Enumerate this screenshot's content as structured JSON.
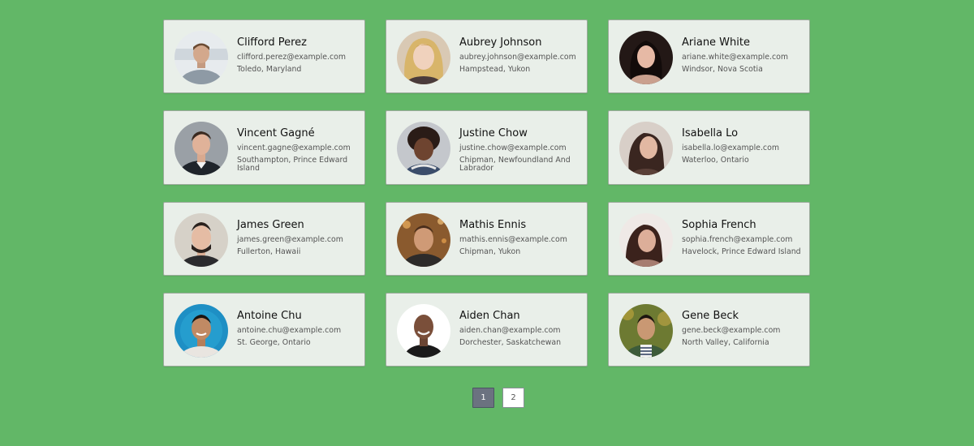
{
  "colors": {
    "background": "#62b767",
    "card": "#e9efe9",
    "active_page": "#6b7280"
  },
  "users": [
    {
      "name": "Clifford Perez",
      "email": "clifford.perez@example.com",
      "location": "Toledo, Maryland"
    },
    {
      "name": "Aubrey Johnson",
      "email": "aubrey.johnson@example.com",
      "location": "Hampstead, Yukon"
    },
    {
      "name": "Ariane White",
      "email": "ariane.white@example.com",
      "location": "Windsor, Nova Scotia"
    },
    {
      "name": "Vincent Gagné",
      "email": "vincent.gagne@example.com",
      "location": "Southampton, Prince Edward Island"
    },
    {
      "name": "Justine Chow",
      "email": "justine.chow@example.com",
      "location": "Chipman, Newfoundland And Labrador"
    },
    {
      "name": "Isabella Lo",
      "email": "isabella.lo@example.com",
      "location": "Waterloo, Ontario"
    },
    {
      "name": "James Green",
      "email": "james.green@example.com",
      "location": "Fullerton, Hawaii"
    },
    {
      "name": "Mathis Ennis",
      "email": "mathis.ennis@example.com",
      "location": "Chipman, Yukon"
    },
    {
      "name": "Sophia French",
      "email": "sophia.french@example.com",
      "location": "Havelock, Prince Edward Island"
    },
    {
      "name": "Antoine Chu",
      "email": "antoine.chu@example.com",
      "location": "St. George, Ontario"
    },
    {
      "name": "Aiden Chan",
      "email": "aiden.chan@example.com",
      "location": "Dorchester, Saskatchewan"
    },
    {
      "name": "Gene Beck",
      "email": "gene.beck@example.com",
      "location": "North Valley, California"
    }
  ],
  "pagination": {
    "pages": [
      "1",
      "2"
    ],
    "current": "1"
  }
}
